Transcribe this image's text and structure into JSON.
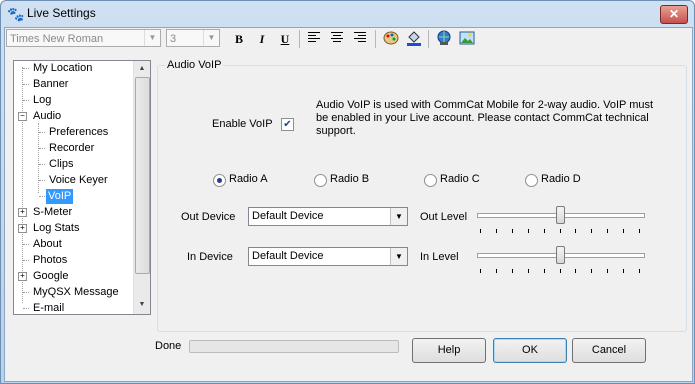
{
  "window": {
    "title": "Live Settings",
    "close_glyph": "✕",
    "icon": "paw-icon"
  },
  "toolbar": {
    "font_name": "Times New Roman",
    "font_size": "3",
    "bold": "B",
    "italic": "I",
    "underline": "U"
  },
  "tree": {
    "items": [
      {
        "label": "My Location"
      },
      {
        "label": "Banner"
      },
      {
        "label": "Log"
      },
      {
        "label": "Audio"
      },
      {
        "label": "Preferences"
      },
      {
        "label": "Recorder"
      },
      {
        "label": "Clips"
      },
      {
        "label": "Voice Keyer"
      },
      {
        "label": "VoIP"
      },
      {
        "label": "S-Meter"
      },
      {
        "label": "Log Stats"
      },
      {
        "label": "About"
      },
      {
        "label": "Photos"
      },
      {
        "label": "Google"
      },
      {
        "label": "MyQSX Message"
      },
      {
        "label": "E-mail"
      }
    ],
    "selected": "VoIP",
    "expander_minus": "−",
    "expander_plus": "+"
  },
  "panel": {
    "group_title": "Audio VoIP",
    "enable_label": "Enable VoIP",
    "enable_checked": true,
    "check_glyph": "✔",
    "info_line1": "Audio VoIP is used with CommCat Mobile for 2-way audio.  VoIP must",
    "info_line2": "be enabled in your Live account.  Please contact CommCat technical",
    "info_line3": "support.",
    "radios": [
      {
        "label": "Radio A",
        "checked": true
      },
      {
        "label": "Radio B",
        "checked": false
      },
      {
        "label": "Radio C",
        "checked": false
      },
      {
        "label": "Radio D",
        "checked": false
      }
    ],
    "out_device_label": "Out Device",
    "out_device_value": "Default Device",
    "out_level_label": "Out Level",
    "out_level": 0.5,
    "in_device_label": "In Device",
    "in_device_value": "Default Device",
    "in_level_label": "In Level",
    "in_level": 0.5
  },
  "status": {
    "label": "Done",
    "progress": 0
  },
  "buttons": {
    "help": "Help",
    "ok": "OK",
    "cancel": "Cancel"
  },
  "colors": {
    "selection": "#3399ff",
    "progress": "#06b025"
  }
}
